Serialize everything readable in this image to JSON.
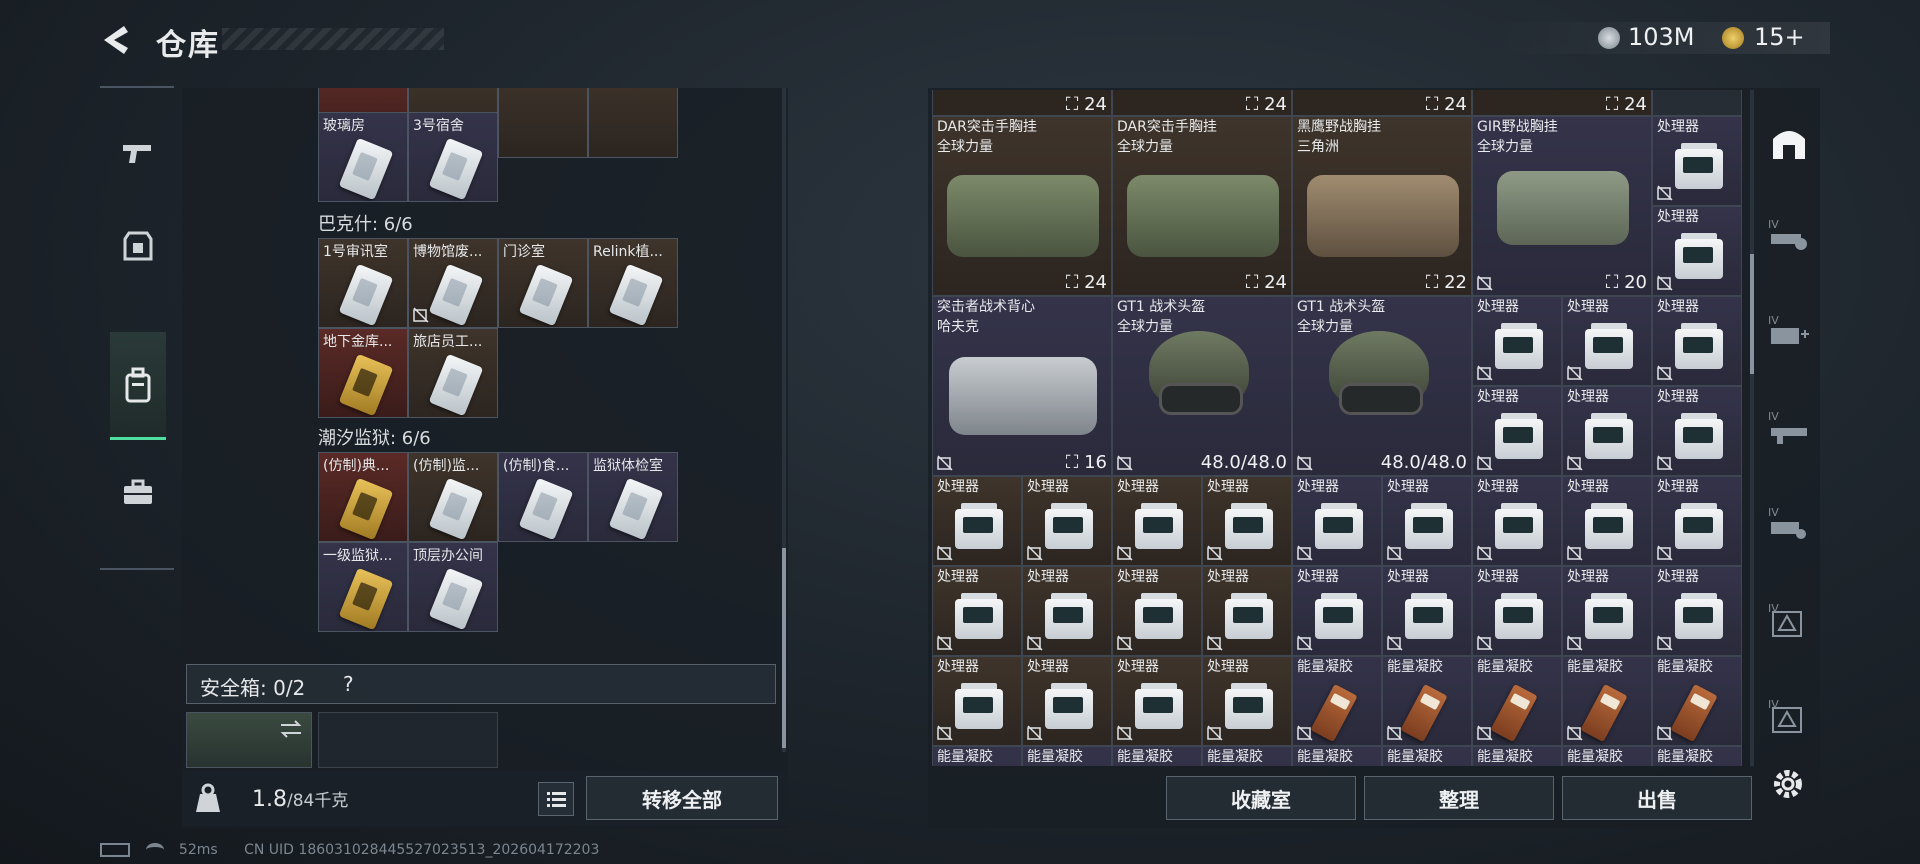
{
  "header": {
    "title": "仓库",
    "currency": [
      {
        "icon": "coin-icon",
        "value": "103M"
      },
      {
        "icon": "gold-badge-icon",
        "value": "15+"
      }
    ]
  },
  "left_rail": [
    "pistol-icon",
    "armor-icon",
    "backpack-icon",
    "toolbox-icon"
  ],
  "keys": {
    "top_labels": [
      "玻璃房",
      "3号宿舍"
    ],
    "groups": [
      {
        "title": "巴克什: 6/6",
        "items": [
          "1号审讯室",
          "博物馆废...",
          "门诊室",
          "Relink植...",
          "地下金库...",
          "旅店员工..."
        ]
      },
      {
        "title": "潮汐监狱: 6/6",
        "items": [
          "(仿制)典...",
          "(仿制)监...",
          "(仿制)食...",
          "监狱体检室",
          "一级监狱...",
          "顶层办公间"
        ]
      }
    ]
  },
  "safebox": {
    "label": "安全箱: 0/2",
    "help": "?"
  },
  "footer_left": {
    "weight": "1.8",
    "weight_max": "/84千克",
    "transfer": "转移全部"
  },
  "grid": {
    "top_stats": [
      "24",
      "24",
      "24",
      "24"
    ],
    "rigs": [
      {
        "name": "DAR突击手胸挂",
        "map": "全球力量",
        "stat": "24"
      },
      {
        "name": "DAR突击手胸挂",
        "map": "全球力量",
        "stat": "24"
      },
      {
        "name": "黑鹰野战胸挂",
        "map": "三角洲",
        "stat": "22"
      },
      {
        "name": "GIR野战胸挂",
        "map": "全球力量",
        "stat": "20"
      }
    ],
    "vest": {
      "name": "突击者战术背心",
      "map": "哈夫克",
      "stat": "16"
    },
    "helmets": [
      {
        "name": "GT1 战术头盔",
        "map": "全球力量",
        "durability": "48.0/48.0"
      },
      {
        "name": "GT1 战术头盔",
        "map": "全球力量",
        "durability": "48.0/48.0"
      }
    ],
    "processor_label": "处理器",
    "gel_label": "能量凝胶"
  },
  "footer_right": {
    "collection": "收藏室",
    "sort": "整理",
    "sell": "出售"
  },
  "status": {
    "ping": "52ms",
    "uid": "CN UID 1860310284455270235​13_202604172203"
  },
  "colors": {
    "accent": "#4fe0a0",
    "panel": "#181e25",
    "brown_cell": "#3e342b",
    "purple_cell": "#34334a"
  }
}
